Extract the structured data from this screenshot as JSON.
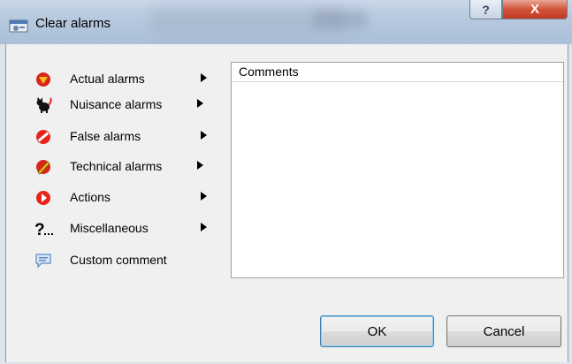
{
  "window": {
    "title": "Clear alarms",
    "help_label": "?",
    "close_label": "X"
  },
  "menu": [
    {
      "label": "Actual alarms",
      "icon": "actual-alarm-icon",
      "submenu": true
    },
    {
      "label": "Nuisance alarms",
      "icon": "nuisance-cat-icon",
      "submenu": true
    },
    {
      "label": "False alarms",
      "icon": "no-entry-icon",
      "submenu": true
    },
    {
      "label": "Technical alarms",
      "icon": "technical-alarm-icon",
      "submenu": true
    },
    {
      "label": "Actions",
      "icon": "play-action-icon",
      "submenu": true
    },
    {
      "label": "Miscellaneous",
      "icon": "question-icon",
      "submenu": true
    },
    {
      "label": "Custom comment",
      "icon": "speech-bubble-icon",
      "submenu": false
    }
  ],
  "comments": {
    "header": "Comments"
  },
  "buttons": {
    "ok": "OK",
    "cancel": "Cancel"
  },
  "colors": {
    "alarm_red": "#d9261c",
    "close_red": "#c23a22",
    "titlebar": "#b6c8de"
  }
}
